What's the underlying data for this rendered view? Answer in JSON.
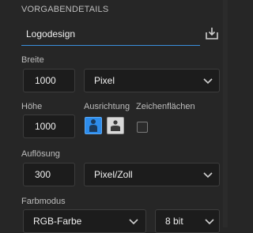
{
  "section": {
    "title": "VORGABENDETAILS"
  },
  "document_name": {
    "value": "Logodesign"
  },
  "width": {
    "label": "Breite",
    "value": "1000",
    "unit": "Pixel"
  },
  "height": {
    "label": "Höhe",
    "value": "1000"
  },
  "orientation": {
    "label": "Ausrichtung",
    "selected": "portrait"
  },
  "artboards": {
    "label": "Zeichenflächen",
    "checked": false
  },
  "resolution": {
    "label": "Auflösung",
    "value": "300",
    "unit": "Pixel/Zoll"
  },
  "color_mode": {
    "label": "Farbmodus",
    "value": "RGB-Farbe",
    "bits": "8 bit"
  },
  "colors": {
    "accent": "#2d8ceb",
    "background": "#262626",
    "field": "#1c1c1c"
  },
  "icons": [
    "save-preset-icon",
    "chevron-down-icon",
    "portrait-icon",
    "landscape-icon"
  ]
}
